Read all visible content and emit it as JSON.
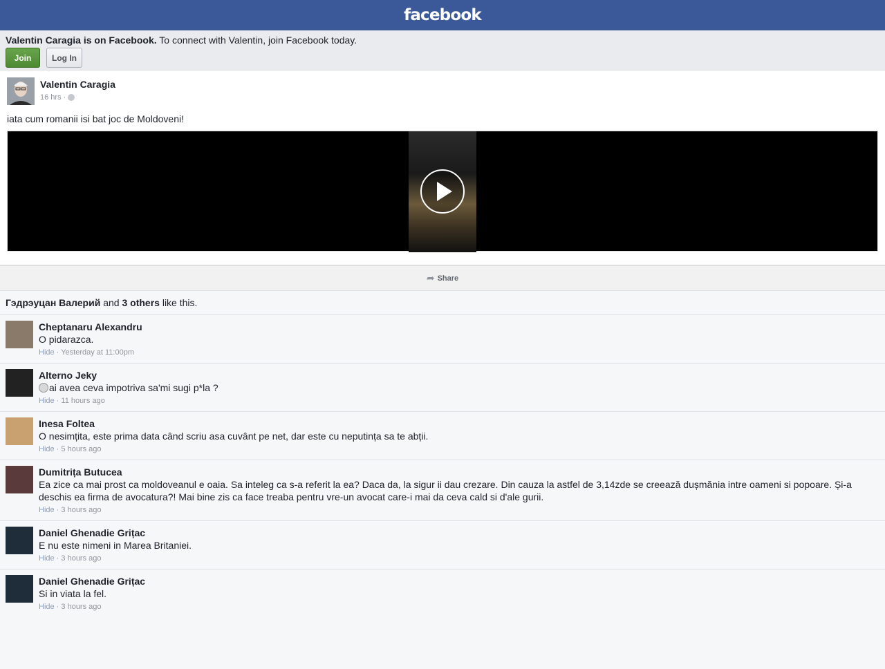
{
  "header": {
    "brand": "facebook"
  },
  "join_banner": {
    "name_bold": "Valentin Caragia is on Facebook.",
    "rest_text": "To connect with Valentin, join Facebook today.",
    "join_label": "Join",
    "login_label": "Log In"
  },
  "post": {
    "author": "Valentin Caragia",
    "time": "16 hrs ·",
    "text": "iata cum romanii isi bat joc de Moldoveni!"
  },
  "share": {
    "label": "Share"
  },
  "likes": {
    "name": "Гэдрэуцан Валерий",
    "and": "and",
    "others": "3 others",
    "tail": "like this."
  },
  "comments": [
    {
      "name": "Cheptanaru Alexandru",
      "text": "O pidarazca.",
      "hide": "Hide",
      "time": "Yesterday at 11:00pm",
      "color": "#8a7a6a"
    },
    {
      "name": "Alterno Jeky",
      "text": "ai avea ceva impotriva sa'mi sugi p*la ?",
      "hide": "Hide",
      "time": "11 hours ago",
      "color": "#222222"
    },
    {
      "name": "Inesa Foltea",
      "text": "O nesimțita, este prima data când scriu asa cuvânt pe net, dar este cu neputința sa te abții.",
      "hide": "Hide",
      "time": "5 hours ago",
      "color": "#c9a070"
    },
    {
      "name": "Dumitrița Butucea",
      "text": "Ea zice ca mai prost ca moldoveanul e oaia. Sa inteleg ca s-a referit la ea? Daca da, la sigur ii dau crezare. Din cauza la astfel de 3,14zde se creează dușmănia intre oameni si popoare. Și-a deschis ea firma de avocatura?! Mai bine zis ca face treaba pentru vre-un avocat care-i mai da ceva cald si d'ale gurii.",
      "hide": "Hide",
      "time": "3 hours ago",
      "color": "#5a3a3a"
    },
    {
      "name": "Daniel Ghenadie Grițac",
      "text": "E nu este nimeni in Marea Britaniei.",
      "hide": "Hide",
      "time": "3 hours ago",
      "color": "#1f2d3a"
    },
    {
      "name": "Daniel Ghenadie Grițac",
      "text": "Si in viata la fel.",
      "hide": "Hide",
      "time": "3 hours ago",
      "color": "#1f2d3a"
    }
  ]
}
